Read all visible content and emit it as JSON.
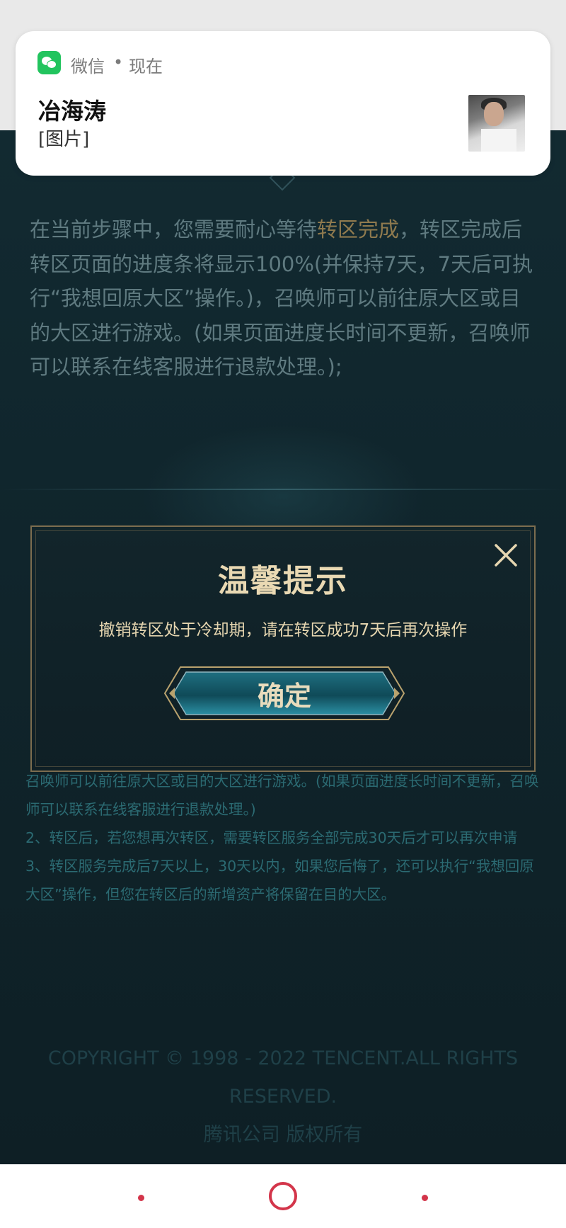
{
  "notification": {
    "app": "微信",
    "separator": "•",
    "time": "现在",
    "sender": "冶海涛",
    "message": "[图片]",
    "icon": "wechat-icon"
  },
  "step_text": {
    "part1": "在当前步骤中，您需要耐心等待",
    "highlight": "转区完成",
    "part2": "，转区完成后转区页面的进度条将显示100%(并保持7天，7天后可执行“我想回原大区”操作。)，召唤师可以前往原大区或目的大区进行游戏。(如果页面进度长时间不更新，召唤师可以联系在线客服进行退款处理。);"
  },
  "notes": [
    "召唤师可以前往原大区或目的大区进行游戏。(如果页面进度长时间不更新，召唤师可以联系在线客服进行退款处理。)",
    "2、转区后，若您想再次转区，需要转区服务全部完成30天后才可以再次申请",
    "3、转区服务完成后7天以上，30天以内，如果您后悔了，还可以执行“我想回原大区”操作，但您在转区后的新增资产将保留在目的大区。"
  ],
  "dialog": {
    "title": "温馨提示",
    "message": "撤销转区处于冷却期，请在转区成功7天后再次操作",
    "confirm_label": "确定"
  },
  "footer": {
    "copyright": "COPYRIGHT © 1998 - 2022 TENCENT.ALL RIGHTS RESERVED.",
    "company": "腾讯公司 版权所有"
  },
  "colors": {
    "page_bg": "#10252c",
    "gold": "#e9d9b3",
    "accent_highlight": "#8f7a4e",
    "nav_red": "#d3354a",
    "wechat_green": "#22c45e"
  }
}
